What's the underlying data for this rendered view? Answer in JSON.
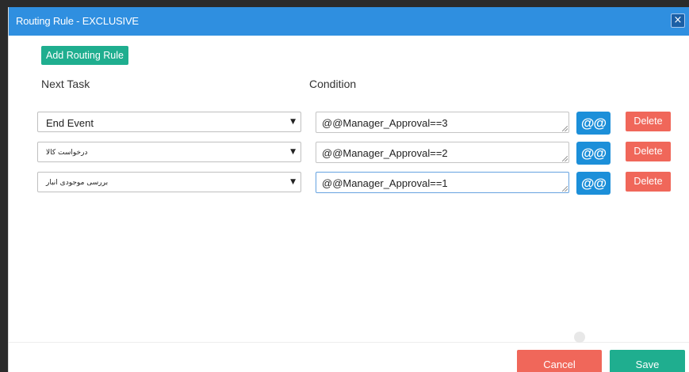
{
  "dialog": {
    "title": "Routing Rule - EXCLUSIVE",
    "close_label": "×",
    "title_bar_color": "#2f8fe0"
  },
  "toolbar": {
    "add_label": "Add Routing Rule"
  },
  "columns": {
    "next_task": "Next Task",
    "condition": "Condition"
  },
  "rules": [
    {
      "task": "End Event",
      "condition": "@@Manager_Approval==3",
      "variable_label": "@@",
      "delete_label": "Delete"
    },
    {
      "task": "درخواست کالا",
      "condition": "@@Manager_Approval==2",
      "variable_label": "@@",
      "delete_label": "Delete"
    },
    {
      "task": "بررسی موجودی انبار",
      "condition": "@@Manager_Approval==1",
      "variable_label": "@@",
      "delete_label": "Delete"
    }
  ],
  "footer": {
    "cancel_label": "Cancel",
    "save_label": "Save"
  },
  "colors": {
    "primary_green": "#1fae8f",
    "danger_red": "#f0675a",
    "variable_blue": "#1c8fd9"
  }
}
